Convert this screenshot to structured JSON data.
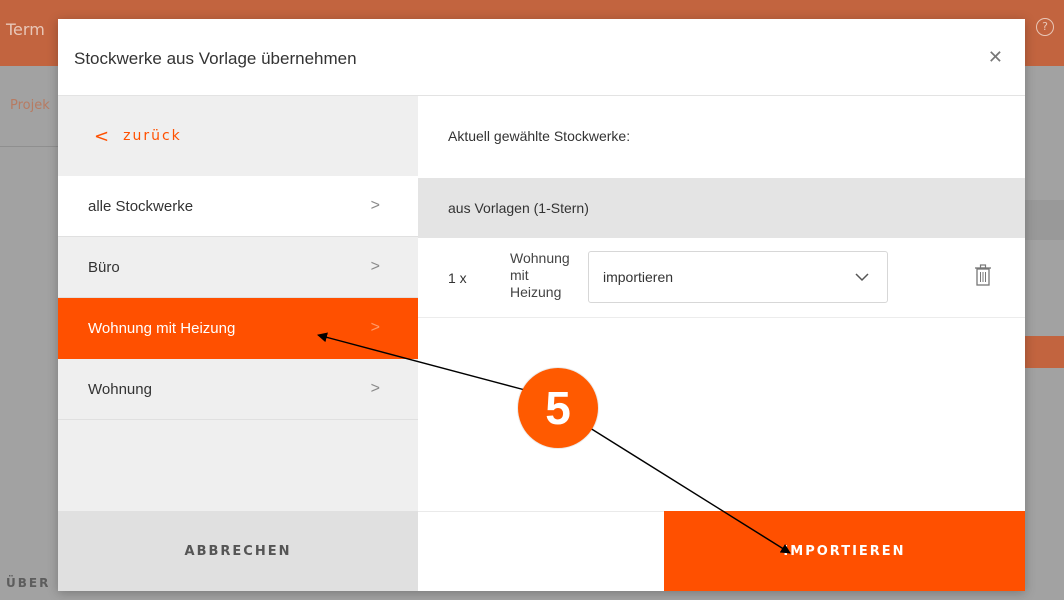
{
  "background": {
    "app_title": "Term",
    "help_icon": "question-circle-icon",
    "breadcrumb": "Projek",
    "footer_label": "ÜBER"
  },
  "modal": {
    "title": "Stockwerke aus Vorlage übernehmen",
    "close_icon": "close-icon",
    "back_label": "zurück",
    "nav_items": [
      {
        "label": "alle Stockwerke",
        "state": "white"
      },
      {
        "label": "Büro",
        "state": "grey"
      },
      {
        "label": "Wohnung mit Heizung",
        "state": "active"
      },
      {
        "label": "Wohnung",
        "state": "grey"
      }
    ],
    "selected_heading": "Aktuell gewählte Stockwerke:",
    "group_label": "aus Vorlagen (1-Stern)",
    "floor": {
      "quantity": "1 x",
      "name": "Wohnung mit Heizung",
      "select_value": "importieren"
    },
    "cancel_label": "ABBRECHEN",
    "import_label": "IMPORTIEREN"
  },
  "annotation": {
    "step_number": "5",
    "accent_color": "#ff5000"
  }
}
